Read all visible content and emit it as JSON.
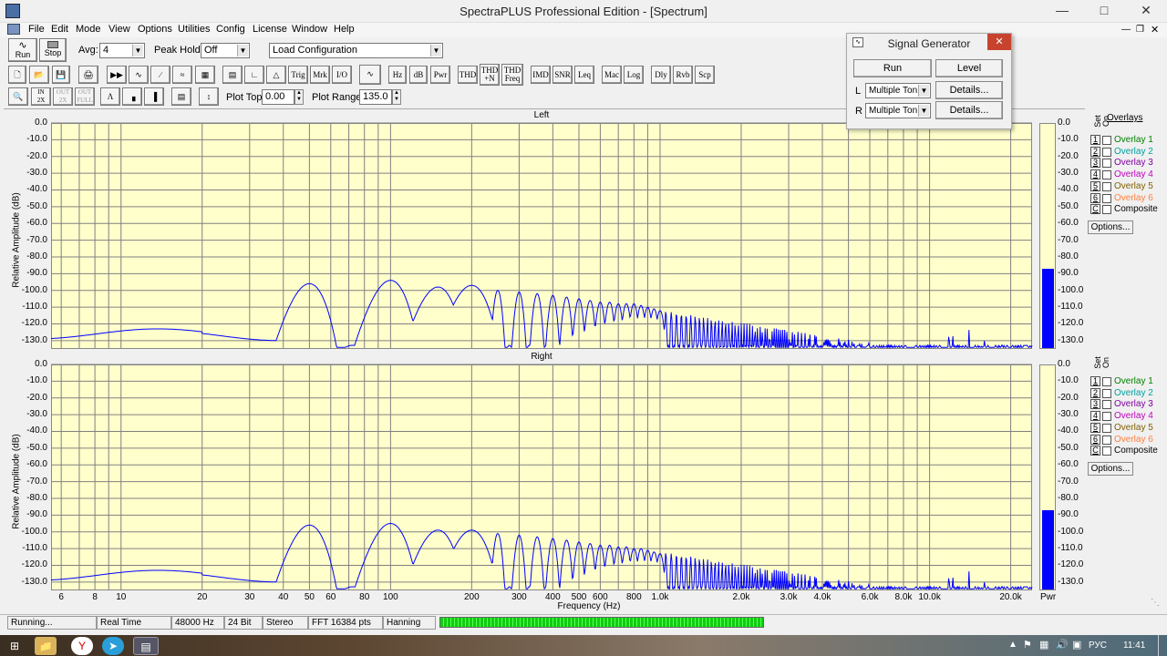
{
  "window": {
    "title": "SpectraPLUS Professional Edition - [Spectrum]"
  },
  "menu": [
    "File",
    "Edit",
    "Mode",
    "View",
    "Options",
    "Utilities",
    "Config",
    "License",
    "Window",
    "Help"
  ],
  "toolbar1": {
    "run_label": "Run",
    "stop_label": "Stop",
    "avg_label": "Avg:",
    "avg_value": "4",
    "peak_hold_label": "Peak Hold:",
    "peak_hold_value": "Off",
    "config_value": "Load Configuration"
  },
  "toolbar2": {
    "buttons": [
      "Trig",
      "Mrk",
      "I/O",
      "Hz",
      "dB",
      "Pwr",
      "THD",
      "THD\n+N",
      "THD\nFreq",
      "IMD",
      "SNR",
      "Leq",
      "Mac",
      "Log",
      "Dly",
      "Rvb",
      "Scp"
    ]
  },
  "toolbar3": {
    "plot_top_label": "Plot Top:",
    "plot_top_value": "0.00",
    "plot_range_label": "Plot Range:",
    "plot_range_value": "135.0"
  },
  "signal_generator": {
    "title": "Signal Generator",
    "run_label": "Run",
    "level_label": "Level",
    "l_label": "L",
    "r_label": "R",
    "l_value": "Multiple Ton",
    "r_value": "Multiple Ton",
    "details_label": "Details..."
  },
  "plots": {
    "left_title": "Left",
    "right_title": "Right",
    "ylabel": "Relative Amplitude (dB)",
    "xlabel": "Frequency (Hz)",
    "y_ticks": [
      "0.0",
      "-10.0",
      "-20.0",
      "-30.0",
      "-40.0",
      "-50.0",
      "-60.0",
      "-70.0",
      "-80.0",
      "-90.0",
      "-100.0",
      "-110.0",
      "-120.0",
      "-130.0"
    ],
    "x_ticks": [
      "6",
      "8",
      "10",
      "20",
      "30",
      "40",
      "50",
      "60",
      "80",
      "100",
      "200",
      "300",
      "400",
      "500",
      "600",
      "800",
      "1.0k",
      "2.0k",
      "3.0k",
      "4.0k",
      "6.0k",
      "8.0k",
      "10.0k",
      "20.0k"
    ],
    "pwr_label": "Pwr"
  },
  "chart_data": {
    "type": "line",
    "xlabel": "Frequency (Hz)",
    "ylabel": "Relative Amplitude (dB)",
    "xscale": "log",
    "xlim": [
      5.5,
      24000
    ],
    "ylim": [
      -135,
      0
    ],
    "grid": true,
    "series": [
      {
        "name": "Left",
        "peaks_hz": [
          50,
          100,
          150,
          200,
          250,
          300,
          350,
          400,
          450,
          500,
          550,
          600,
          650,
          700,
          750,
          800,
          850,
          900,
          950,
          1000
        ],
        "peaks_db": [
          -96,
          -94,
          -98,
          -97,
          -100,
          -101,
          -102,
          -103,
          -104,
          -105,
          -106,
          -107,
          -107,
          -108,
          -108,
          -108,
          -109,
          -110,
          -111,
          -112
        ],
        "floor_db": -134,
        "pwr_meter_db": -87
      },
      {
        "name": "Right",
        "peaks_hz": [
          50,
          100,
          150,
          200,
          250,
          300,
          350,
          400,
          450,
          500,
          550,
          600,
          650,
          700,
          750,
          800,
          850,
          900,
          950,
          1000
        ],
        "peaks_db": [
          -96,
          -95,
          -99,
          -99,
          -101,
          -102,
          -103,
          -104,
          -105,
          -106,
          -107,
          -108,
          -108,
          -109,
          -109,
          -110,
          -110,
          -111,
          -112,
          -113
        ],
        "floor_db": -134,
        "pwr_meter_db": -87
      }
    ]
  },
  "overlays": {
    "title": "Overlays",
    "set_label": "Set",
    "on_label": "On",
    "items": [
      {
        "key": "1",
        "label": "Overlay 1",
        "color": "#008000"
      },
      {
        "key": "2",
        "label": "Overlay 2",
        "color": "#00a0a0"
      },
      {
        "key": "3",
        "label": "Overlay 3",
        "color": "#8000a0"
      },
      {
        "key": "4",
        "label": "Overlay 4",
        "color": "#c000c0"
      },
      {
        "key": "5",
        "label": "Overlay 5",
        "color": "#806000"
      },
      {
        "key": "6",
        "label": "Overlay 6",
        "color": "#ff8040"
      },
      {
        "key": "C",
        "label": "Composite",
        "color": "#000000"
      }
    ],
    "options_label": "Options..."
  },
  "status": {
    "state": "Running...",
    "mode": "Real Time",
    "rate": "48000 Hz",
    "bits": "24 Bit",
    "channels": "Stereo",
    "fft": "FFT 16384 pts",
    "window": "Hanning"
  },
  "taskbar": {
    "lang": "РУС",
    "time": "11:41"
  }
}
